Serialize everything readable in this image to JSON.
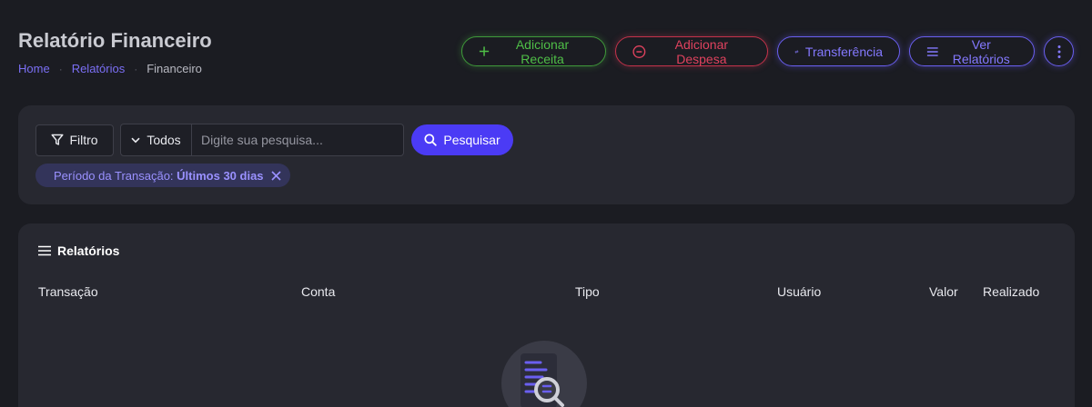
{
  "header": {
    "title": "Relatório Financeiro",
    "breadcrumb": [
      "Home",
      "Relatórios",
      "Financeiro"
    ]
  },
  "actions": {
    "add_income": "Adicionar Receita",
    "add_expense": "Adicionar Despesa",
    "transfer": "Transferência",
    "view_reports": "Ver Relatórios"
  },
  "filters": {
    "filter_label": "Filtro",
    "scope_select": "Todos",
    "search_placeholder": "Digite sua pesquisa...",
    "search_value": "",
    "search_button": "Pesquisar",
    "active_filter": {
      "label": "Período da Transação:",
      "value": "Últimos 30 dias"
    }
  },
  "reports": {
    "title": "Relatórios",
    "columns": [
      "Transação",
      "Conta",
      "Tipo",
      "Usuário",
      "Valor",
      "Realizado"
    ]
  },
  "colors": {
    "background": "#1b1c22",
    "card": "#272830",
    "accent": "#4b3bf5",
    "success": "#4fbf47",
    "danger": "#e0425e"
  }
}
